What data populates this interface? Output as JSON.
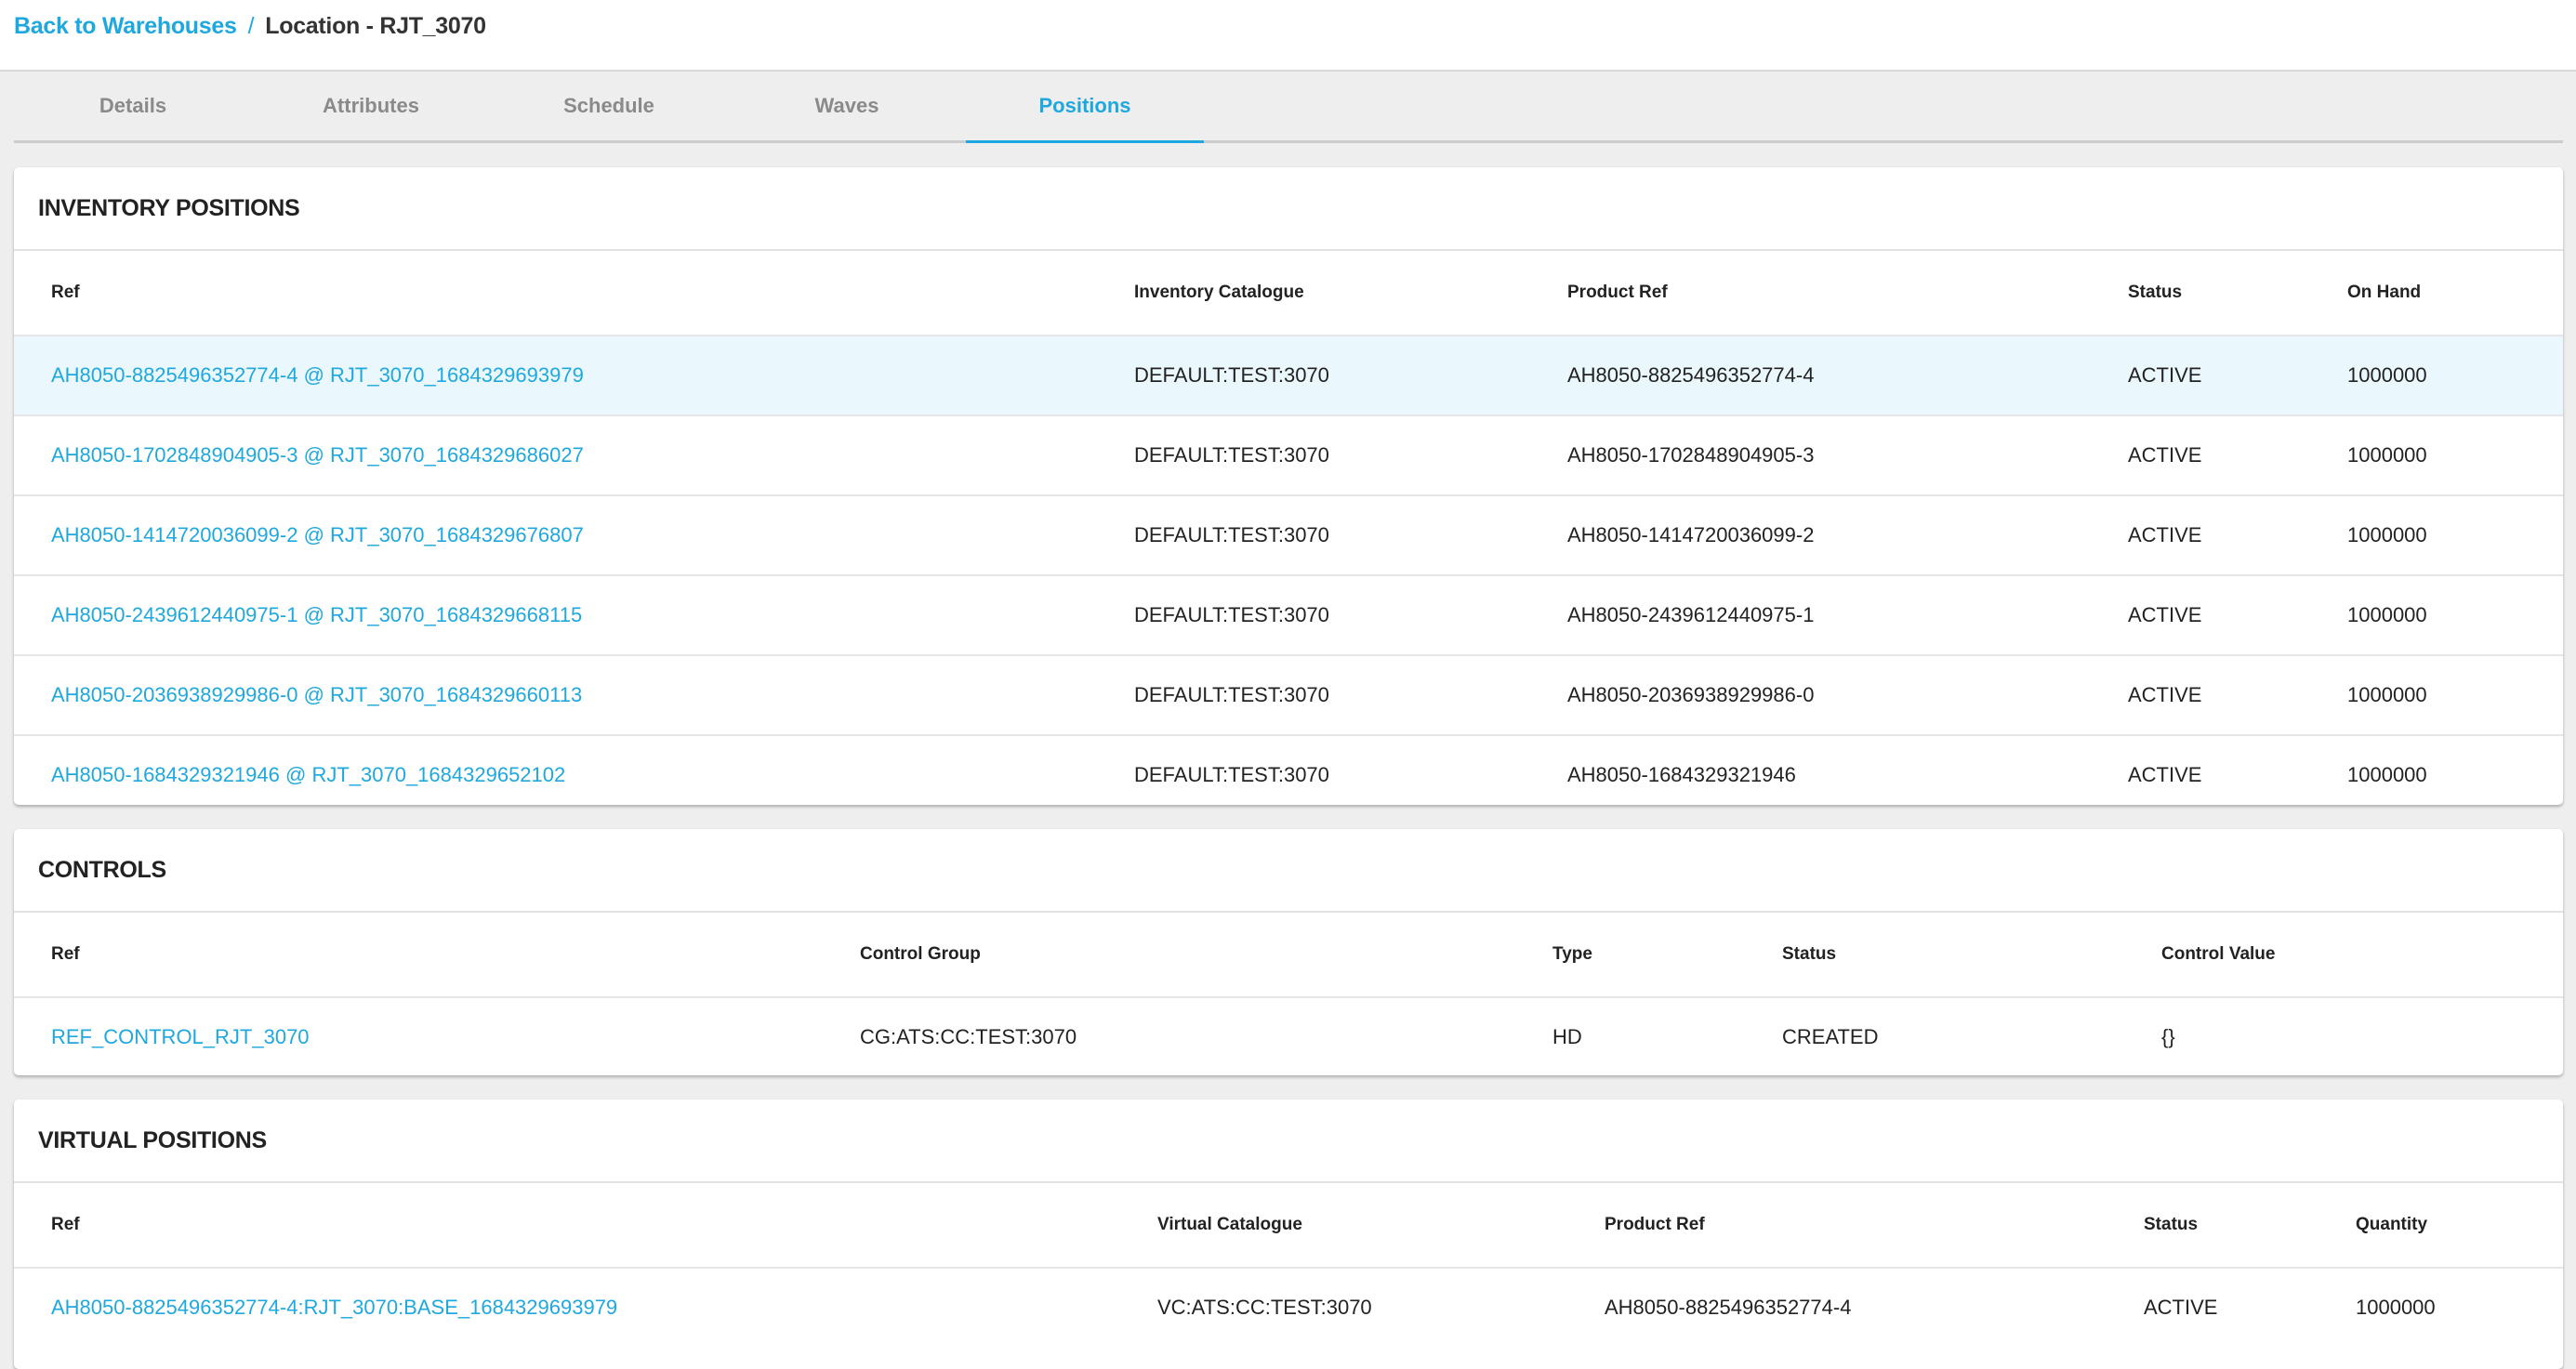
{
  "breadcrumb": {
    "back_label": "Back to Warehouses",
    "separator": "/",
    "current": "Location - RJT_3070"
  },
  "tabs": [
    {
      "label": "Details",
      "active": false
    },
    {
      "label": "Attributes",
      "active": false
    },
    {
      "label": "Schedule",
      "active": false
    },
    {
      "label": "Waves",
      "active": false
    },
    {
      "label": "Positions",
      "active": true
    }
  ],
  "colors": {
    "accent": "#1fa8df",
    "row_highlight": "#eaf8fd",
    "background": "#eeeeee",
    "text": "#222222"
  },
  "inventory_positions": {
    "title": "INVENTORY POSITIONS",
    "columns": [
      "Ref",
      "Inventory Catalogue",
      "Product Ref",
      "Status",
      "On Hand"
    ],
    "rows": [
      [
        "AH8050-8825496352774-4 @ RJT_3070_1684329693979",
        "DEFAULT:TEST:3070",
        "AH8050-8825496352774-4",
        "ACTIVE",
        "1000000"
      ],
      [
        "AH8050-1702848904905-3 @ RJT_3070_1684329686027",
        "DEFAULT:TEST:3070",
        "AH8050-1702848904905-3",
        "ACTIVE",
        "1000000"
      ],
      [
        "AH8050-1414720036099-2 @ RJT_3070_1684329676807",
        "DEFAULT:TEST:3070",
        "AH8050-1414720036099-2",
        "ACTIVE",
        "1000000"
      ],
      [
        "AH8050-2439612440975-1 @ RJT_3070_1684329668115",
        "DEFAULT:TEST:3070",
        "AH8050-2439612440975-1",
        "ACTIVE",
        "1000000"
      ],
      [
        "AH8050-2036938929986-0 @ RJT_3070_1684329660113",
        "DEFAULT:TEST:3070",
        "AH8050-2036938929986-0",
        "ACTIVE",
        "1000000"
      ],
      [
        "AH8050-1684329321946 @ RJT_3070_1684329652102",
        "DEFAULT:TEST:3070",
        "AH8050-1684329321946",
        "ACTIVE",
        "1000000"
      ]
    ]
  },
  "controls": {
    "title": "CONTROLS",
    "columns": [
      "Ref",
      "Control Group",
      "Type",
      "Status",
      "Control Value"
    ],
    "rows": [
      [
        "REF_CONTROL_RJT_3070",
        "CG:ATS:CC:TEST:3070",
        "HD",
        "CREATED",
        "{}"
      ]
    ]
  },
  "virtual_positions": {
    "title": "VIRTUAL POSITIONS",
    "columns": [
      "Ref",
      "Virtual Catalogue",
      "Product Ref",
      "Status",
      "Quantity"
    ],
    "rows": [
      [
        "AH8050-8825496352774-4:RJT_3070:BASE_1684329693979",
        "VC:ATS:CC:TEST:3070",
        "AH8050-8825496352774-4",
        "ACTIVE",
        "1000000"
      ]
    ]
  }
}
